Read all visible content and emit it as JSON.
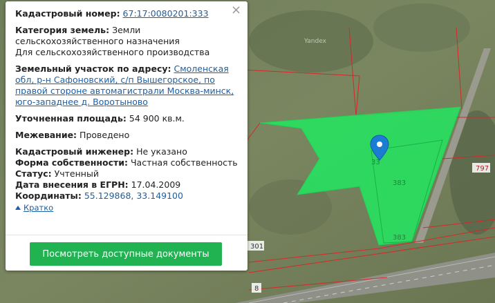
{
  "map": {
    "watermark": "Yandex",
    "parcel_labels": [
      "33",
      "383",
      "383"
    ],
    "road_labels": [
      "797",
      "301",
      "8"
    ]
  },
  "popup": {
    "close_glyph": "×",
    "cadastral_label": "Кадастровый номер:",
    "cadastral_value": "67:17:0080201:333",
    "category_label": "Категория земель:",
    "category_value_1": "Земли",
    "category_value_2": "сельскохозяйственного назначения",
    "category_value_3": "Для сельскохозяйственного производства",
    "address_label": "Земельный участок по адресу:",
    "address_value_1": "Смоленская",
    "address_value_2": "обл, р-н Сафоновский, с/п Вышегорское, по",
    "address_value_3": "правой стороне автомагистрали Москва-минск,",
    "address_value_4": "юго-западнее д. Воротыново",
    "area_label": "Уточненная площадь:",
    "area_value": "54 900 кв.м.",
    "survey_label": "Межевание:",
    "survey_value": "Проведено",
    "engineer_label": "Кадастровый инженер:",
    "engineer_value": "Не указано",
    "ownership_label": "Форма собственности:",
    "ownership_value": "Частная собственность",
    "status_label": "Статус:",
    "status_value": "Учтенный",
    "date_label": "Дата внесения в ЕГРН:",
    "date_value": "17.04.2009",
    "coords_label": "Координаты:",
    "coords_value": "55.129868, 33.149100",
    "collapse_label": "Кратко",
    "docs_button": "Посмотреть доступные документы"
  },
  "colors": {
    "parcel_fill": "#22e860",
    "marker": "#1c7bd3",
    "button": "#21b352",
    "link": "#1a5fa8",
    "boundary": "#d62828"
  }
}
